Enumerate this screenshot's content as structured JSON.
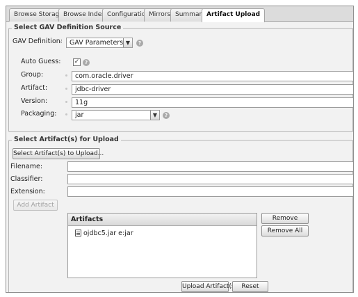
{
  "tabs": [
    {
      "label": "Browse Storage",
      "active": false
    },
    {
      "label": "Browse Index",
      "active": false
    },
    {
      "label": "Configuration",
      "active": false
    },
    {
      "label": "Mirrors",
      "active": false
    },
    {
      "label": "Summary",
      "active": false
    },
    {
      "label": "Artifact Upload",
      "active": true
    }
  ],
  "gav_section": {
    "title": "Select GAV Definition Source",
    "gav_definition_label": "GAV Definition:",
    "gav_definition_value": "GAV Parameters",
    "auto_guess_label": "Auto Guess:",
    "auto_guess_checked": true,
    "group_label": "Group:",
    "group_value": "com.oracle.driver",
    "artifact_label": "Artifact:",
    "artifact_value": "jdbc-driver",
    "version_label": "Version:",
    "version_value": "11g",
    "packaging_label": "Packaging:",
    "packaging_value": "jar"
  },
  "artifact_section": {
    "title": "Select Artifact(s) for Upload",
    "select_button": "Select Artifact(s) to Upload...",
    "filename_label": "Filename:",
    "classifier_label": "Classifier:",
    "extension_label": "Extension:",
    "add_artifact_button": "Add Artifact",
    "artifacts_header": "Artifacts",
    "artifacts": [
      "ojdbc5.jar e:jar"
    ],
    "remove_button": "Remove",
    "remove_all_button": "Remove All"
  },
  "footer": {
    "upload_button": "Upload Artifact(s)",
    "reset_button": "Reset"
  },
  "colors": {
    "panel_bg": "#f2f2f2",
    "border": "#8f8f8f"
  }
}
